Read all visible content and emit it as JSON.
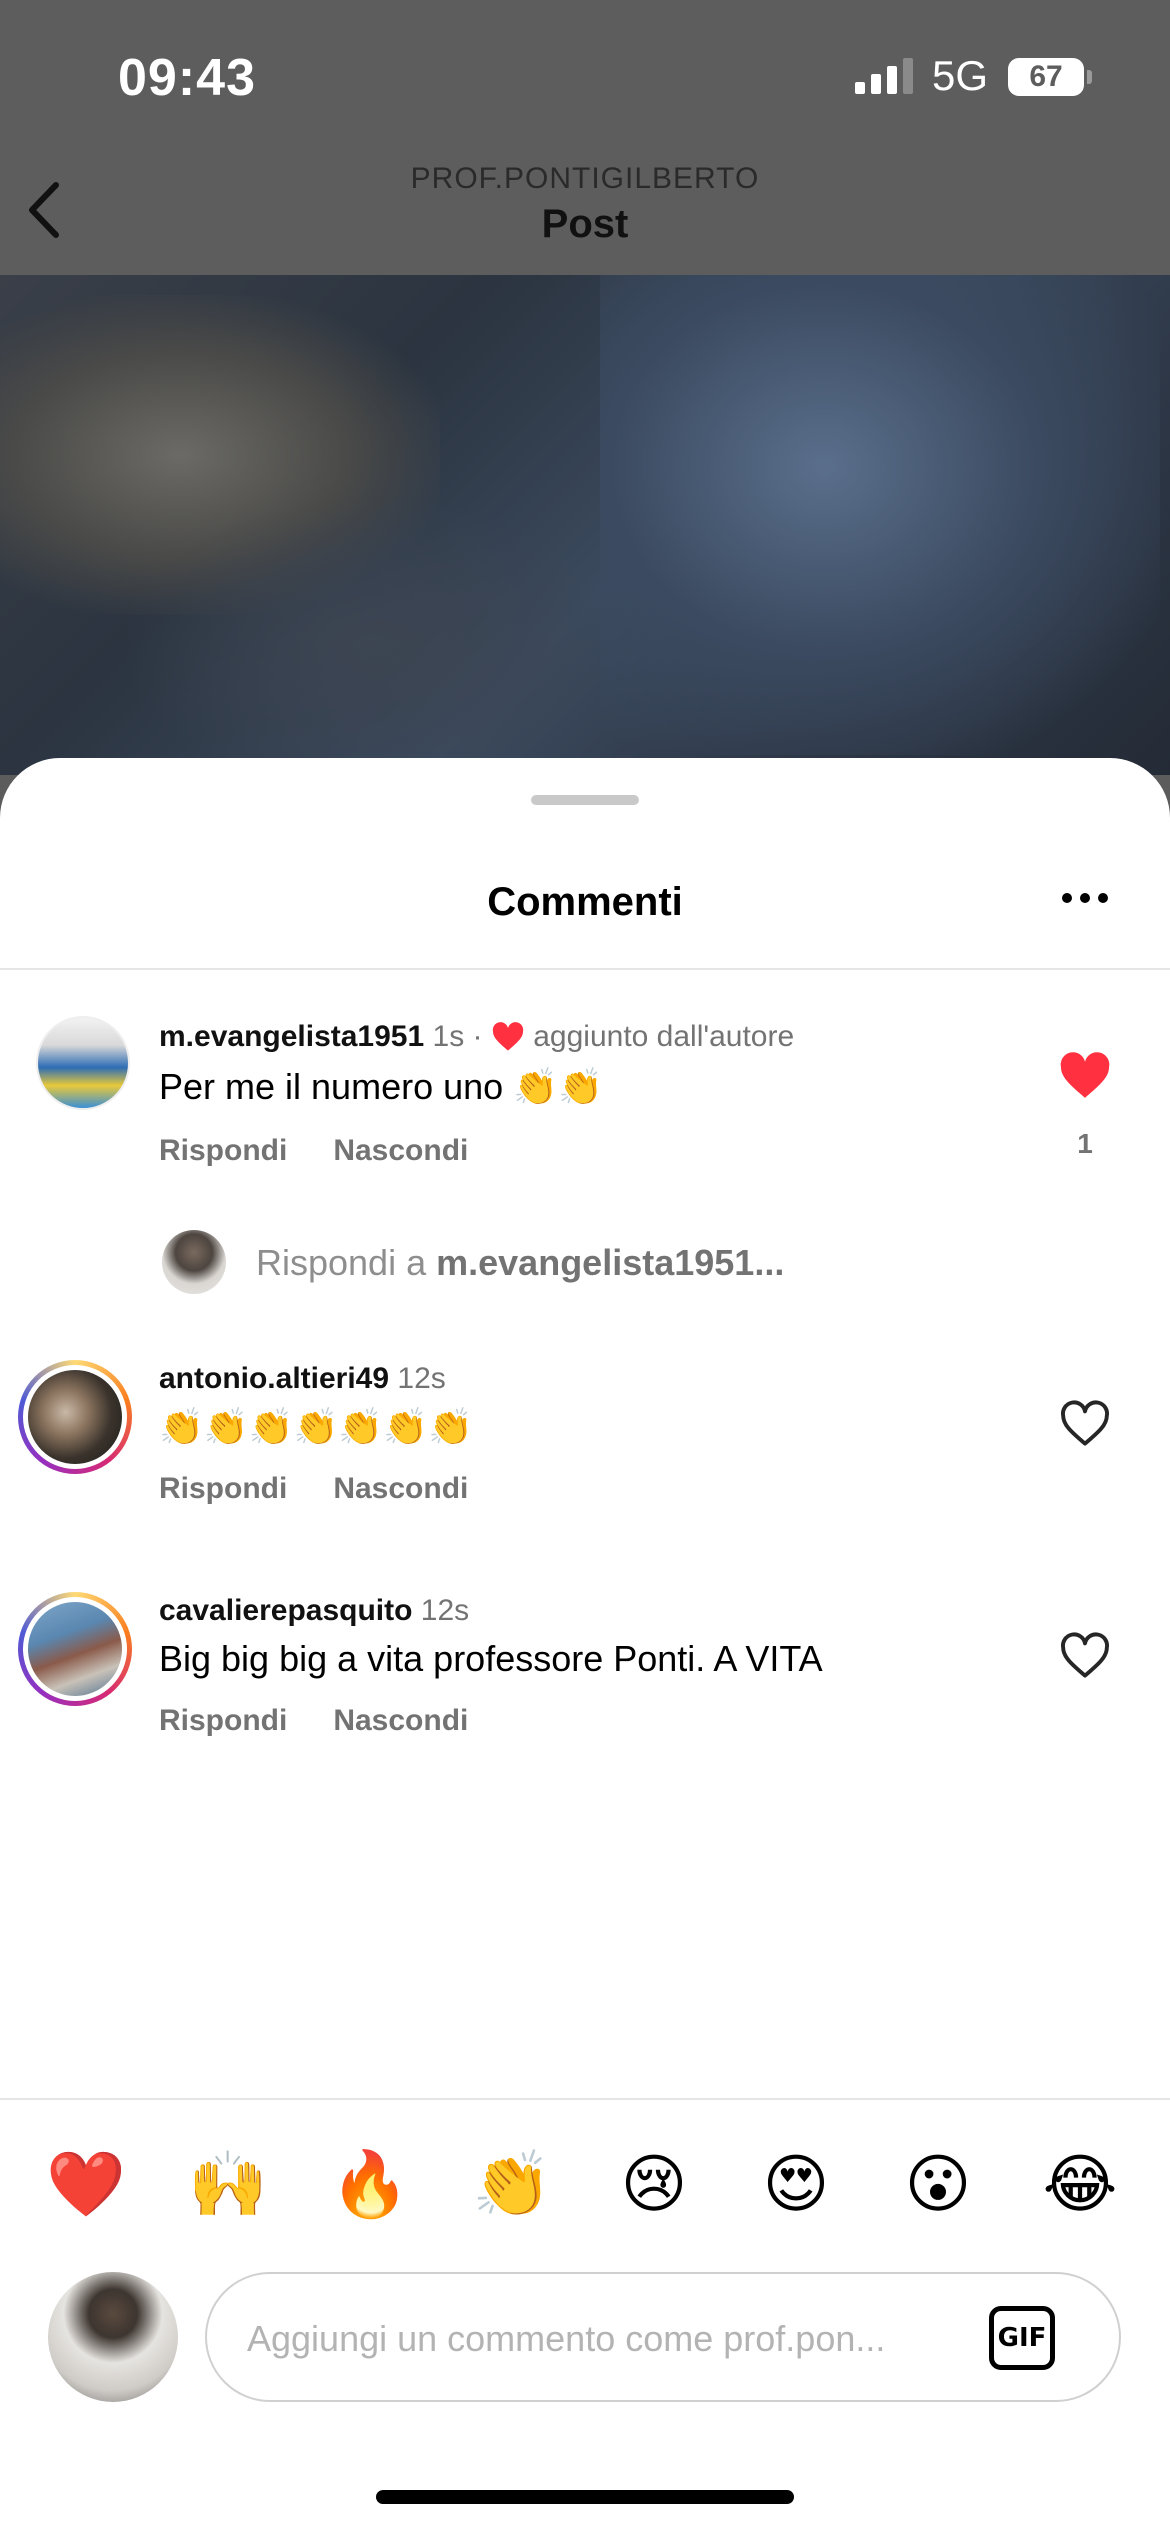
{
  "status_bar": {
    "time": "09:43",
    "network": "5G",
    "battery": "67"
  },
  "header": {
    "subtitle": "PROF.PONTIGILBERTO",
    "title": "Post"
  },
  "sheet": {
    "title": "Commenti"
  },
  "comments": [
    {
      "username": "m.evangelista1951",
      "time": "1s",
      "separator": "·",
      "author_note": "aggiunto dall'autore",
      "text": "Per me il numero uno 👏👏",
      "reply_label": "Rispondi",
      "hide_label": "Nascondi",
      "liked": true,
      "like_count": "1"
    },
    {
      "username": "antonio.altieri49",
      "time": "12s",
      "text": "👏👏👏👏👏👏👏",
      "reply_label": "Rispondi",
      "hide_label": "Nascondi",
      "liked": false
    },
    {
      "username": "cavalierepasquito",
      "time": "12s",
      "text": "Big big big a vita professore Ponti. A VITA",
      "reply_label": "Rispondi",
      "hide_label": "Nascondi",
      "liked": false
    }
  ],
  "reply_prompt": {
    "prefix": "Rispondi a",
    "target": "m.evangelista1951..."
  },
  "emoji_bar": [
    "❤️",
    "🙌",
    "🔥",
    "👏",
    "😢",
    "😍",
    "😮",
    "😂"
  ],
  "composer": {
    "placeholder": "Aggiungi un commento come prof.pon...",
    "gif_label": "GIF"
  },
  "colors": {
    "like_red": "#ff3040",
    "text_secondary": "#737373"
  }
}
